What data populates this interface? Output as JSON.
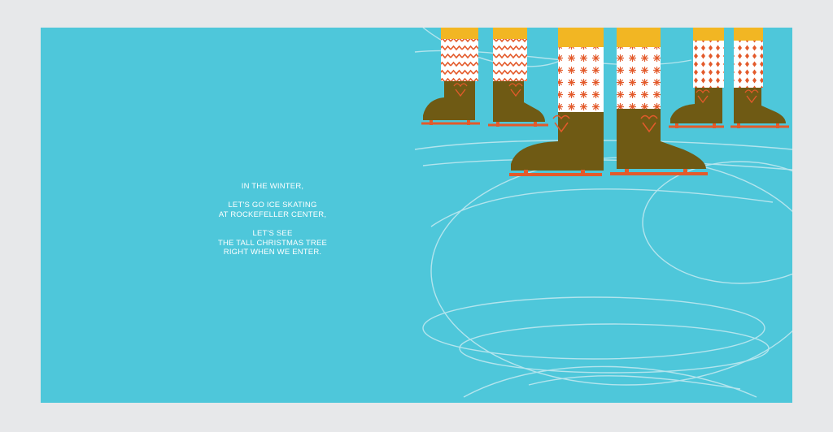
{
  "page": {
    "background": "#e7e8ea"
  },
  "spread": {
    "background": "#4ec7da",
    "text": {
      "stanza1": [
        "IN THE WINTER,"
      ],
      "stanza2": [
        "LET'S GO ICE SKATING",
        "AT ROCKEFELLER CENTER,"
      ],
      "stanza3": [
        "LET'S SEE",
        "THE TALL CHRISTMAS TREE",
        "RIGHT WHEN WE ENTER."
      ]
    },
    "illustration": {
      "subject": "ice skates",
      "colors": {
        "boot": "#6f5a14",
        "blade": "#e35a2b",
        "sock_top": "#f2b623",
        "sock_pattern": "#e35a2b",
        "sock_base": "#ffffff",
        "ice_lines": "#bfe8f0"
      }
    }
  }
}
